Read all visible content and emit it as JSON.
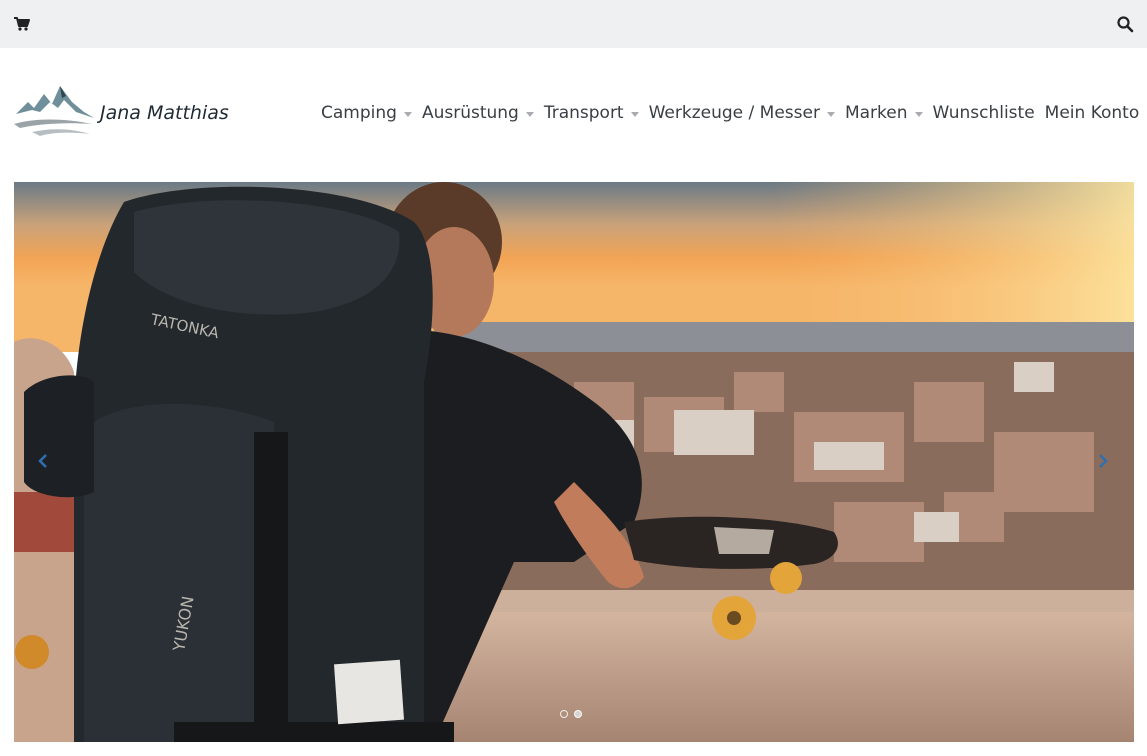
{
  "topbar": {
    "cart_icon": "shopping-cart-icon",
    "search_icon": "search-icon"
  },
  "brand": {
    "name": "Jana Matthias",
    "logo_icon": "mountain-road-logo",
    "colors": {
      "mountain": "#6f8f9a",
      "road": "#9aa3a8",
      "text": "#1f2a33"
    }
  },
  "nav": {
    "items": [
      {
        "label": "Camping",
        "has_dropdown": true
      },
      {
        "label": "Ausrüstung",
        "has_dropdown": true
      },
      {
        "label": "Transport",
        "has_dropdown": true
      },
      {
        "label": "Werkzeuge / Messer",
        "has_dropdown": true
      },
      {
        "label": "Marken",
        "has_dropdown": true
      },
      {
        "label": "Wunschliste",
        "has_dropdown": false
      },
      {
        "label": "Mein Konto",
        "has_dropdown": false
      }
    ]
  },
  "hero": {
    "backpack_brand": "TATONKA",
    "backpack_model": "YUKON",
    "prev_icon": "chevron-left-icon",
    "next_icon": "chevron-right-icon",
    "slides_total": 2,
    "active_slide": 2
  }
}
